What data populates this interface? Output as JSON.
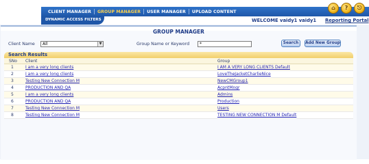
{
  "nav": {
    "tabs": [
      {
        "label": "CLIENT MANAGER",
        "active": false
      },
      {
        "label": "GROUP MANAGER",
        "active": true
      },
      {
        "label": "USER MANAGER",
        "active": false
      },
      {
        "label": "UPLOAD CONTENT",
        "active": false
      }
    ],
    "subnav": "DYNAMIC ACCESS FILTERS",
    "icons": [
      "home-icon",
      "help-icon",
      "logout-icon"
    ],
    "welcome": "WELCOME vaidy1 vaidy1",
    "portal_link": "Reporting Portal"
  },
  "page": {
    "title": "GROUP MANAGER",
    "client_label": "Client Name",
    "client_value": "All",
    "keyword_label": "Group Name or Keyword",
    "keyword_value": "*",
    "search_button": "Search",
    "add_button": "Add New Group"
  },
  "results": {
    "title": "Search Results",
    "columns": [
      "SNo",
      "Client",
      "Group"
    ],
    "rows": [
      {
        "sno": "1",
        "client": "I am a very long clients",
        "group": "I AM A VERY LONG CLIENTS Default"
      },
      {
        "sno": "2",
        "client": "I am a very long clients",
        "group": "LoveTheJacketCharlieNice"
      },
      {
        "sno": "3",
        "client": "Testing New Connection M",
        "group": "NewCMGroup1"
      },
      {
        "sno": "4",
        "client": "PRODUCTION AND QA",
        "group": "AcpntMngr"
      },
      {
        "sno": "5",
        "client": "I am a very long clients",
        "group": "Admins"
      },
      {
        "sno": "6",
        "client": "PRODUCTION AND QA",
        "group": "Production"
      },
      {
        "sno": "7",
        "client": "Testing New Connection M",
        "group": "Users"
      },
      {
        "sno": "8",
        "client": "Testing New Connection M",
        "group": "TESTING NEW CONNECTION M Default"
      }
    ]
  },
  "colors": {
    "nav_blue": "#1f57a8",
    "active_tab": "#ffd24a",
    "header_gold": "#f2cf6a",
    "link": "#1f1fb0"
  }
}
